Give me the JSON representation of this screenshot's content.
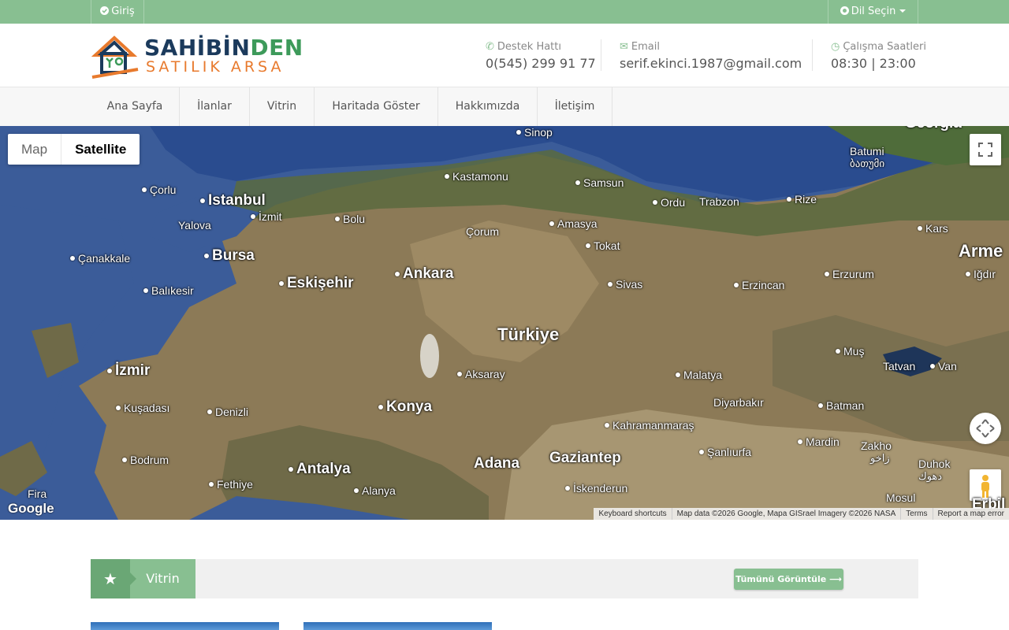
{
  "topbar": {
    "login_label": "Giriş",
    "language_label": "Dil Seçin",
    "background_color": "#88bf91"
  },
  "header": {
    "logo_line1_a": "SAHİBİN",
    "logo_line1_b": "DEN",
    "logo_line2": "SATILIK ARSA",
    "support_label": "Destek Hattı",
    "support_value": "0(545) 299 91 77",
    "email_label": "Email",
    "email_value": "serif.ekinci.1987@gmail.com",
    "hours_label": "Çalışma Saatleri",
    "hours_value": "08:30 | 23:00"
  },
  "nav": {
    "items": [
      "Ana Sayfa",
      "İlanlar",
      "Vitrin",
      "Haritada Göster",
      "Hakkımızda",
      "İletişim"
    ]
  },
  "map": {
    "type_map": "Map",
    "type_satellite": "Satellite",
    "selected_type": "Satellite",
    "google_logo": "Google",
    "attribution": [
      "Keyboard shortcuts",
      "Map data ©2026 Google, Mapa GISrael Imagery ©2026 NASA",
      "Terms",
      "Report a map error"
    ],
    "country_label": "Türkiye",
    "cities": {
      "sinop": "Sinop",
      "kastamonu": "Kastamonu",
      "samsun": "Samsun",
      "batumi": "Batumi",
      "batumi_ge": "ბათუმი",
      "corlu": "Çorlu",
      "istanbul": "Istanbul",
      "izmit": "İzmit",
      "bolu": "Bolu",
      "yalova": "Yalova",
      "corum": "Çorum",
      "amasya": "Amasya",
      "ordu": "Ordu",
      "trabzon": "Trabzon",
      "rize": "Rize",
      "kars": "Kars",
      "canakkale": "Çanakkale",
      "bursa": "Bursa",
      "tokat": "Tokat",
      "armenia": "Arme",
      "eskisehir": "Eskişehir",
      "ankara": "Ankara",
      "sivas": "Sivas",
      "erzincan": "Erzincan",
      "erzurum": "Erzurum",
      "igdir": "Iğdır",
      "balikesir": "Balıkesir",
      "mus": "Muş",
      "tatvan": "Tatvan",
      "van": "Van",
      "izmir": "İzmir",
      "aksaray": "Aksaray",
      "malatya": "Malatya",
      "kusadasi": "Kuşadası",
      "denizli": "Denizli",
      "konya": "Konya",
      "diyarbakir": "Diyarbakır",
      "batman": "Batman",
      "kahramanmaras": "Kahramanmaraş",
      "mardin": "Mardin",
      "zakho": "Zakho",
      "zakho_ar": "زاخو",
      "bodrum": "Bodrum",
      "antalya": "Antalya",
      "adana": "Adana",
      "gaziantep": "Gaziantep",
      "sanliurfa": "Şanlıurfa",
      "duhok": "Duhok",
      "duhok_ar": "دهوك",
      "fira": "Fira",
      "fethiye": "Fethiye",
      "alanya": "Alanya",
      "iskenderun": "İskenderun",
      "mosul": "Mosul",
      "erbil": "Erbil",
      "georgia": "Georgia"
    }
  },
  "vitrin": {
    "title": "Vitrin",
    "view_all_label": "Tümünü Görüntüle",
    "accent_color": "#88bf91"
  }
}
